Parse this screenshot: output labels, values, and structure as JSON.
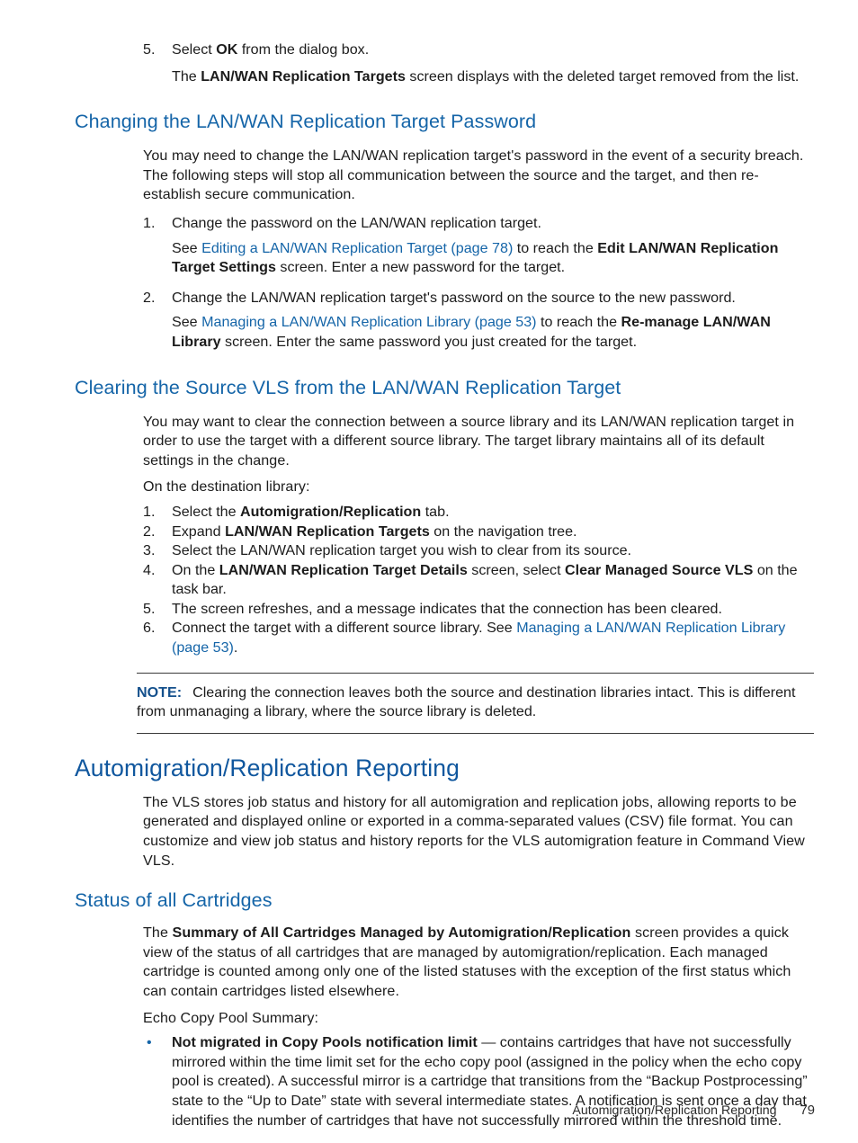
{
  "colors": {
    "heading_primary": "#10579e",
    "heading_secondary": "#1565a8",
    "link": "#1565a8",
    "note_label": "#14508c",
    "bullet": "#1565a8",
    "body_text": "#1c1c1c"
  },
  "intro_list": {
    "item5_number": "5.",
    "item5_pre": "Select ",
    "item5_bold": "OK",
    "item5_post": " from the dialog box.",
    "item5_sub_pre": "The ",
    "item5_sub_bold": "LAN/WAN Replication Targets",
    "item5_sub_post": " screen displays with the deleted target removed from the list."
  },
  "section_password": {
    "heading": "Changing the LAN/WAN Replication Target Password",
    "intro": "You may need to change the LAN/WAN replication target's password in the event of a security breach. The following steps will stop all communication between the source and the target, and then re-establish secure communication.",
    "steps": [
      {
        "number": "1.",
        "text": "Change the password on the LAN/WAN replication target.",
        "sub_pre": "See ",
        "sub_link": "Editing a LAN/WAN Replication Target (page 78)",
        "sub_mid": " to reach the ",
        "sub_bold": "Edit LAN/WAN Replication Target Settings",
        "sub_post": " screen. Enter a new password for the target."
      },
      {
        "number": "2.",
        "text": "Change the LAN/WAN replication target's password on the source to the new password.",
        "sub_pre": "See ",
        "sub_link": "Managing a LAN/WAN Replication Library (page 53)",
        "sub_mid": " to reach the ",
        "sub_bold": "Re-manage LAN/WAN Library",
        "sub_post": " screen. Enter the same password you just created for the target."
      }
    ]
  },
  "section_clearing": {
    "heading": "Clearing the Source VLS from the LAN/WAN Replication Target",
    "intro": "You may want to clear the connection between a source library and its LAN/WAN replication target in order to use the target with a different source library. The target library maintains all of its default settings in the change.",
    "lead_in": "On the destination library:",
    "steps": [
      {
        "number": "1.",
        "pre": "Select the ",
        "bold": "Automigration/Replication",
        "post": " tab."
      },
      {
        "number": "2.",
        "pre": "Expand ",
        "bold": "LAN/WAN Replication Targets",
        "post": " on the navigation tree."
      },
      {
        "number": "3.",
        "pre": "Select the LAN/WAN replication target you wish to clear from its source.",
        "bold": "",
        "post": ""
      },
      {
        "number": "4.",
        "pre": "On the ",
        "bold": "LAN/WAN Replication Target Details",
        "mid": " screen, select ",
        "bold2": "Clear Managed Source VLS",
        "post": " on the task bar."
      },
      {
        "number": "5.",
        "pre": "The screen refreshes, and a message indicates that the connection has been cleared.",
        "bold": "",
        "post": ""
      },
      {
        "number": "6.",
        "pre": "Connect the target with a different source library. See ",
        "link": "Managing a LAN/WAN Replication Library (page 53)",
        "post": "."
      }
    ],
    "note_label": "NOTE:",
    "note_text": "Clearing the connection leaves both the source and destination libraries intact. This is different from unmanaging a library, where the source library is deleted."
  },
  "section_reporting": {
    "heading": "Automigration/Replication Reporting",
    "body": "The VLS stores job status and history for all automigration and replication jobs, allowing reports to be generated and displayed online or exported in a comma-separated values (CSV) file format. You can customize and view job status and history reports for the VLS automigration feature in Command View VLS."
  },
  "section_status": {
    "heading": "Status of all Cartridges",
    "para_pre": "The ",
    "para_bold": "Summary of All Cartridges Managed by Automigration/Replication",
    "para_post": " screen provides a quick view of the status of all cartridges that are managed by automigration/replication. Each managed cartridge is counted among only one of the listed statuses with the exception of the first status which can contain cartridges listed elsewhere.",
    "lead_in": "Echo Copy Pool Summary:",
    "bullets": [
      {
        "marker": "•",
        "bold": "Not migrated in Copy Pools notification limit",
        "text": " — contains cartridges that have not successfully mirrored within the time limit set for the echo copy pool (assigned in the policy when the echo copy pool is created). A successful mirror is a cartridge that transitions from the “Backup Postprocessing” state to the “Up to Date” state with several intermediate states. A notification is sent once a day that identifies the number of cartridges that have not successfully mirrored within the threshold time."
      }
    ]
  },
  "footer": {
    "title": "Automigration/Replication Reporting",
    "page_number": "79"
  }
}
